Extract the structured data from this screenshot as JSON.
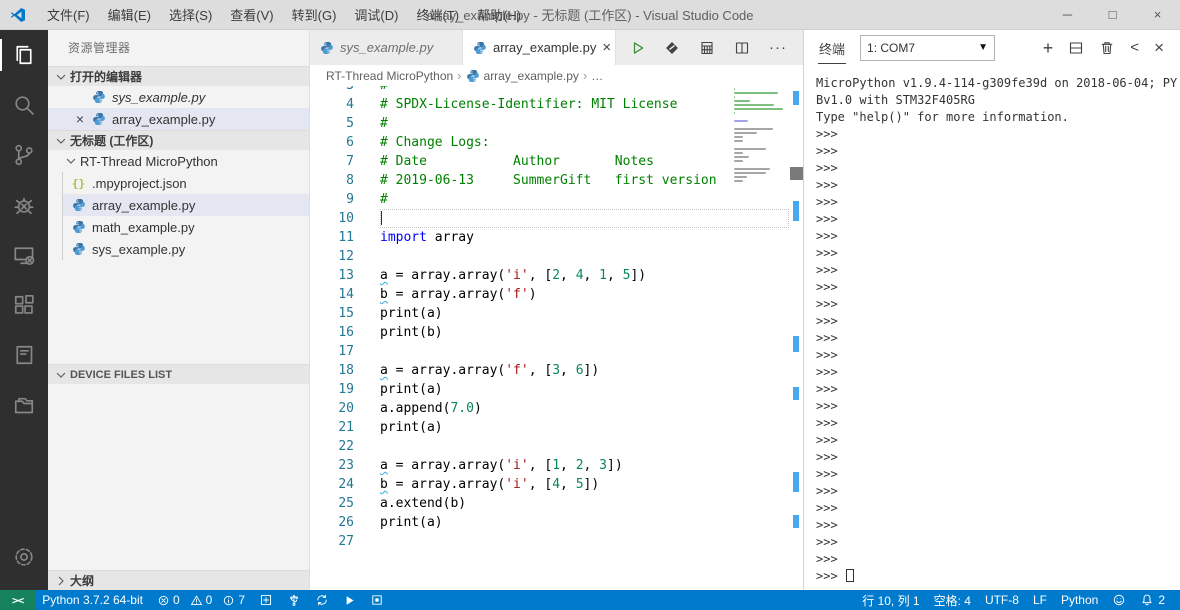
{
  "window": {
    "title": "array_example.py - 无标题 (工作区) - Visual Studio Code",
    "menus": [
      "文件(F)",
      "编辑(E)",
      "选择(S)",
      "查看(V)",
      "转到(G)",
      "调试(D)",
      "终端(T)",
      "帮助(H)"
    ],
    "controls": [
      {
        "name": "minimize-button",
        "glyph": "─"
      },
      {
        "name": "maximize-button",
        "glyph": "□"
      },
      {
        "name": "close-button",
        "glyph": "×"
      }
    ]
  },
  "activity_bar": {
    "items": [
      {
        "name": "explorer",
        "active": true
      },
      {
        "name": "search",
        "active": false
      },
      {
        "name": "source-control",
        "active": false
      },
      {
        "name": "debug",
        "active": false
      },
      {
        "name": "remote-device",
        "active": false
      },
      {
        "name": "extensions",
        "active": false
      },
      {
        "name": "project",
        "active": false
      },
      {
        "name": "device-files",
        "active": false
      }
    ],
    "bottom": [
      {
        "name": "settings",
        "active": false
      }
    ]
  },
  "sidebar": {
    "title": "资源管理器",
    "open_editors": {
      "label": "打开的编辑器",
      "rows": [
        {
          "label": "sys_example.py",
          "icon": "python",
          "italic": true,
          "selected": false,
          "close": false
        },
        {
          "label": "array_example.py",
          "icon": "python",
          "italic": false,
          "selected": true,
          "close": true
        }
      ]
    },
    "workspace": {
      "label": "无标题 (工作区)",
      "folder": "RT-Thread MicroPython",
      "files": [
        {
          "label": ".mpyproject.json",
          "icon": "json",
          "selected": false
        },
        {
          "label": "array_example.py",
          "icon": "python",
          "selected": true
        },
        {
          "label": "math_example.py",
          "icon": "python",
          "selected": false
        },
        {
          "label": "sys_example.py",
          "icon": "python",
          "selected": false
        }
      ]
    },
    "device_files": {
      "label": "DEVICE FILES LIST"
    },
    "outline": {
      "label": "大纲"
    }
  },
  "editor": {
    "tabs": [
      {
        "label": "sys_example.py",
        "icon": "python",
        "active": false,
        "preview": true,
        "close": false
      },
      {
        "label": "array_example.py",
        "icon": "python",
        "active": true,
        "preview": false,
        "close": true
      }
    ],
    "actions": [
      {
        "name": "run-file",
        "icon": "play-green"
      },
      {
        "name": "download-to-device",
        "icon": "diamond"
      },
      {
        "name": "memory-board",
        "icon": "board-grid"
      },
      {
        "name": "split-editor",
        "icon": "split-vertical"
      },
      {
        "name": "more-actions",
        "icon": "ellipsis"
      }
    ],
    "breadcrumb": [
      {
        "label": "RT-Thread MicroPython",
        "icon": null
      },
      {
        "label": "array_example.py",
        "icon": "python"
      },
      {
        "label": "…",
        "icon": null
      }
    ],
    "code_lines": [
      {
        "n": 3,
        "t": [
          [
            "c",
            "#"
          ]
        ]
      },
      {
        "n": 4,
        "t": [
          [
            "c",
            "# SPDX-License-Identifier: MIT License"
          ]
        ]
      },
      {
        "n": 5,
        "t": [
          [
            "c",
            "#"
          ]
        ]
      },
      {
        "n": 6,
        "t": [
          [
            "c",
            "# Change Logs:"
          ]
        ]
      },
      {
        "n": 7,
        "t": [
          [
            "c",
            "# Date           Author       Notes"
          ]
        ]
      },
      {
        "n": 8,
        "t": [
          [
            "c",
            "# 2019-06-13     SummerGift   first version"
          ]
        ]
      },
      {
        "n": 9,
        "t": [
          [
            "c",
            "#"
          ]
        ]
      },
      {
        "n": 10,
        "t": [],
        "cur": true
      },
      {
        "n": 11,
        "t": [
          [
            "k",
            "import"
          ],
          [
            "p",
            " array"
          ]
        ]
      },
      {
        "n": 12,
        "t": []
      },
      {
        "n": 13,
        "t": [
          [
            "w",
            "a"
          ],
          [
            "p",
            " = array.array("
          ],
          [
            "s",
            "'i'"
          ],
          [
            "p",
            ", ["
          ],
          [
            "n",
            "2"
          ],
          [
            "p",
            ", "
          ],
          [
            "n",
            "4"
          ],
          [
            "p",
            ", "
          ],
          [
            "n",
            "1"
          ],
          [
            "p",
            ", "
          ],
          [
            "n",
            "5"
          ],
          [
            "p",
            "])"
          ]
        ]
      },
      {
        "n": 14,
        "t": [
          [
            "w",
            "b"
          ],
          [
            "p",
            " = array.array("
          ],
          [
            "s",
            "'f'"
          ],
          [
            "p",
            ")"
          ]
        ]
      },
      {
        "n": 15,
        "t": [
          [
            "p",
            "print(a)"
          ]
        ]
      },
      {
        "n": 16,
        "t": [
          [
            "p",
            "print(b)"
          ]
        ]
      },
      {
        "n": 17,
        "t": []
      },
      {
        "n": 18,
        "t": [
          [
            "w",
            "a"
          ],
          [
            "p",
            " = array.array("
          ],
          [
            "s",
            "'f'"
          ],
          [
            "p",
            ", ["
          ],
          [
            "n",
            "3"
          ],
          [
            "p",
            ", "
          ],
          [
            "n",
            "6"
          ],
          [
            "p",
            "])"
          ]
        ]
      },
      {
        "n": 19,
        "t": [
          [
            "p",
            "print(a)"
          ]
        ]
      },
      {
        "n": 20,
        "t": [
          [
            "p",
            "a.append("
          ],
          [
            "n",
            "7.0"
          ],
          [
            "p",
            ")"
          ]
        ]
      },
      {
        "n": 21,
        "t": [
          [
            "p",
            "print(a)"
          ]
        ]
      },
      {
        "n": 22,
        "t": []
      },
      {
        "n": 23,
        "t": [
          [
            "w",
            "a"
          ],
          [
            "p",
            " = array.array("
          ],
          [
            "s",
            "'i'"
          ],
          [
            "p",
            ", ["
          ],
          [
            "n",
            "1"
          ],
          [
            "p",
            ", "
          ],
          [
            "n",
            "2"
          ],
          [
            "p",
            ", "
          ],
          [
            "n",
            "3"
          ],
          [
            "p",
            "])"
          ]
        ]
      },
      {
        "n": 24,
        "t": [
          [
            "w",
            "b"
          ],
          [
            "p",
            " = array.array("
          ],
          [
            "s",
            "'i'"
          ],
          [
            "p",
            ", ["
          ],
          [
            "n",
            "4"
          ],
          [
            "p",
            ", "
          ],
          [
            "n",
            "5"
          ],
          [
            "p",
            "])"
          ]
        ]
      },
      {
        "n": 25,
        "t": [
          [
            "p",
            "a.extend(b)"
          ]
        ]
      },
      {
        "n": 26,
        "t": [
          [
            "p",
            "print(a)"
          ]
        ]
      },
      {
        "n": 27,
        "t": []
      }
    ]
  },
  "terminal": {
    "tab_label": "终端",
    "port_value": "1: COM7",
    "actions": [
      {
        "name": "new-terminal",
        "icon": "plus"
      },
      {
        "name": "split-terminal",
        "icon": "split-horizontal"
      },
      {
        "name": "kill-terminal",
        "icon": "trash"
      },
      {
        "name": "move-panel",
        "icon": "chevron-left"
      },
      {
        "name": "close-panel",
        "icon": "close"
      }
    ],
    "banner_lines": [
      "MicroPython v1.9.4-114-g309fe39d on 2018-06-04; PY",
      "Bv1.0 with STM32F405RG",
      "Type \"help()\" for more information."
    ],
    "prompt": ">>>",
    "prompt_count": 26,
    "has_cursor_prompt": true
  },
  "status_bar": {
    "remote_glyph": "><",
    "python_version": "Python 3.7.2 64-bit",
    "problems": {
      "errors": "0",
      "warnings": "0",
      "infos": "7"
    },
    "left_buttons": [
      {
        "name": "flash-board",
        "icon": "board-plus"
      },
      {
        "name": "usb-connect",
        "icon": "usb"
      },
      {
        "name": "sync-device",
        "icon": "sync"
      },
      {
        "name": "run-device",
        "icon": "play-small"
      },
      {
        "name": "stop-device",
        "icon": "stop-square"
      }
    ],
    "right_items": [
      {
        "name": "cursor-position",
        "label": "行 10, 列 1"
      },
      {
        "name": "indentation",
        "label": "空格: 4"
      },
      {
        "name": "encoding",
        "label": "UTF-8"
      },
      {
        "name": "eol",
        "label": "LF"
      },
      {
        "name": "language-mode",
        "label": "Python"
      },
      {
        "name": "feedback",
        "icon": "smiley"
      },
      {
        "name": "notifications",
        "icon": "bell",
        "label": "2"
      }
    ]
  },
  "colors": {
    "statusbar_bg": "#007acc",
    "remote_bg": "#16825d",
    "activitybar_bg": "#2f2f2f",
    "titlebar_bg": "#dddddd",
    "sidebar_bg": "#f3f3f3",
    "selection_bg": "#e4e6f1",
    "comment": "#008000",
    "keyword": "#0000ff",
    "string": "#a31515",
    "number": "#098658",
    "squiggle": "#3fa9e0",
    "run_green": "#388a34",
    "python_icon_top": "#3775a9",
    "python_icon_bottom": "#4e9cd5"
  }
}
